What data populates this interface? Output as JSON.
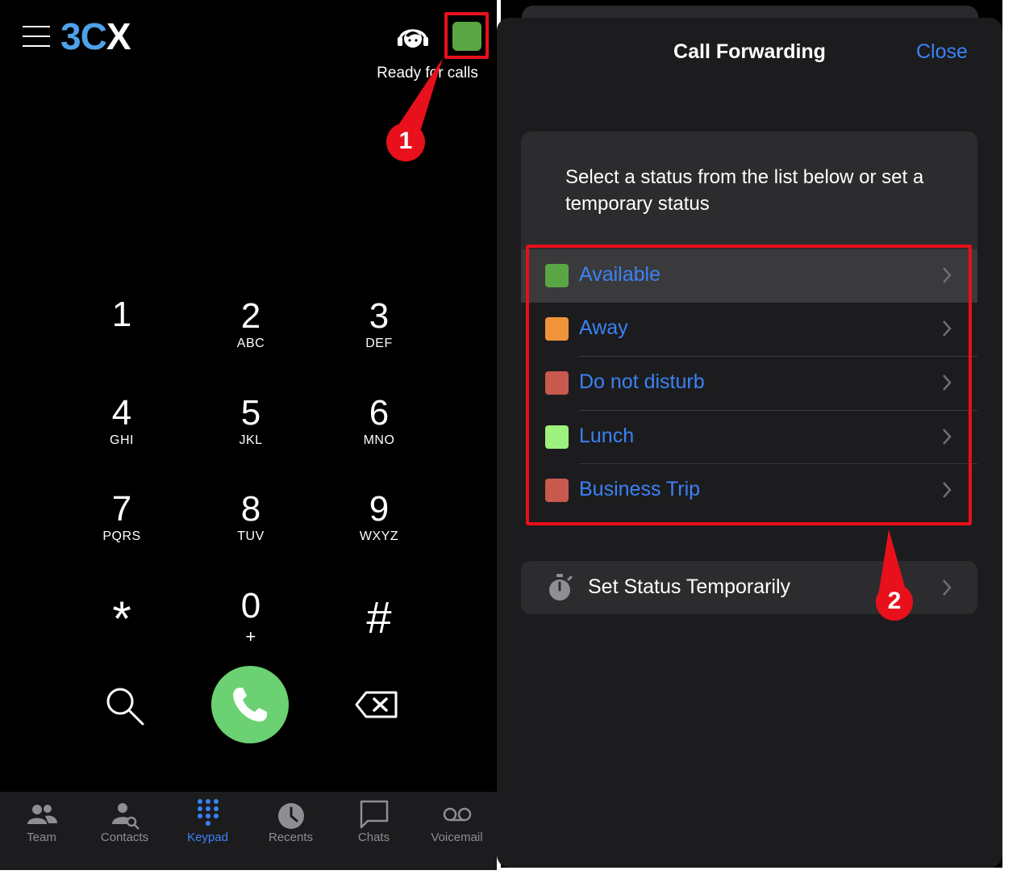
{
  "left": {
    "logo": {
      "part1": "3",
      "part2": "C",
      "part3": "X"
    },
    "status_color": "#5aa544",
    "status_text": "Ready for calls",
    "callout_1": "1",
    "keypad": [
      {
        "digit": "1",
        "letters": ""
      },
      {
        "digit": "2",
        "letters": "ABC"
      },
      {
        "digit": "3",
        "letters": "DEF"
      },
      {
        "digit": "4",
        "letters": "GHI"
      },
      {
        "digit": "5",
        "letters": "JKL"
      },
      {
        "digit": "6",
        "letters": "MNO"
      },
      {
        "digit": "7",
        "letters": "PQRS"
      },
      {
        "digit": "8",
        "letters": "TUV"
      },
      {
        "digit": "9",
        "letters": "WXYZ"
      },
      {
        "digit": "*",
        "letters": ""
      },
      {
        "digit": "0",
        "letters": "+"
      },
      {
        "digit": "#",
        "letters": ""
      }
    ],
    "tabs": [
      {
        "label": "Team",
        "icon": "team-icon",
        "active": false
      },
      {
        "label": "Contacts",
        "icon": "contacts-icon",
        "active": false
      },
      {
        "label": "Keypad",
        "icon": "keypad-icon",
        "active": true
      },
      {
        "label": "Recents",
        "icon": "recents-icon",
        "active": false
      },
      {
        "label": "Chats",
        "icon": "chats-icon",
        "active": false
      },
      {
        "label": "Voicemail",
        "icon": "voicemail-icon",
        "active": false
      }
    ]
  },
  "right": {
    "title": "Call Forwarding",
    "close_label": "Close",
    "instructions": "Select a status from the list below or set a temporary status",
    "statuses": [
      {
        "label": "Available",
        "color": "#5aa544",
        "selected": true
      },
      {
        "label": "Away",
        "color": "#f0943c"
      },
      {
        "label": "Do not disturb",
        "color": "#c9594d"
      },
      {
        "label": "Lunch",
        "color": "#9cf27c"
      },
      {
        "label": "Business Trip",
        "color": "#c9594d"
      }
    ],
    "temporary_label": "Set Status Temporarily",
    "callout_2": "2"
  },
  "colors": {
    "accent": "#3b82f6",
    "annotation_red": "#e8101b",
    "call_green": "#6bd172"
  }
}
